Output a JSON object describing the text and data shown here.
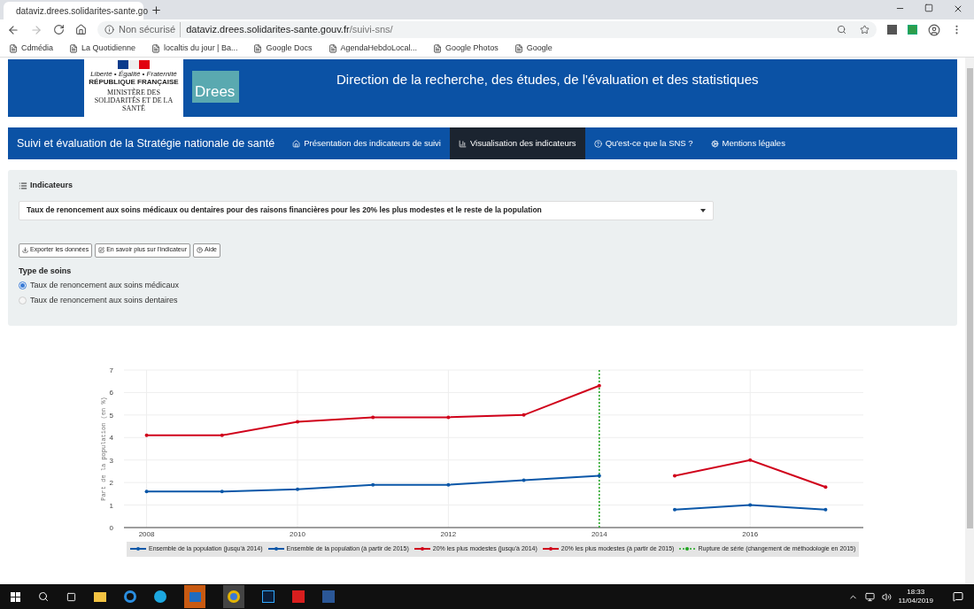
{
  "browser": {
    "tab_title": "dataviz.drees.solidarites-sante.go",
    "security": "Non sécurisé",
    "host": "dataviz.drees.solidarites-sante.gouv.fr",
    "path": "/suivi-sns/",
    "bookmarks": [
      "Cdmédia",
      "La Quotidienne",
      "localtis du jour | Ba...",
      "Google Docs",
      "AgendaHebdoLocal...",
      "Google Photos",
      "Google"
    ]
  },
  "header": {
    "republic_motto": "Liberté • Égalité • Fraternité",
    "republic": "RÉPUBLIQUE FRANÇAISE",
    "ministry": "MINISTÈRE DES SOLIDARITÉS ET DE LA SANTÉ",
    "drees_logo": "Drees",
    "title": "Direction de la recherche, des études, de l'évaluation et des statistiques"
  },
  "nav": {
    "brand": "Suivi et évaluation de la Stratégie nationale de santé",
    "items": [
      {
        "label": "Présentation des indicateurs de suivi",
        "selected": false
      },
      {
        "label": "Visualisation des indicateurs",
        "selected": true
      },
      {
        "label": "Qu'est-ce que la SNS ?",
        "selected": false
      },
      {
        "label": "Mentions légales",
        "selected": false
      }
    ]
  },
  "panel": {
    "heading": "Indicateurs",
    "select_value": "Taux de renoncement aux soins médicaux ou dentaires pour des raisons financières pour les 20% les plus modestes et le reste de la population",
    "buttons": [
      "Exporter les données",
      "En savoir plus sur l'indicateur",
      "Aide"
    ],
    "radio_label": "Type de soins",
    "options": [
      {
        "label": "Taux de renoncement aux soins médicaux",
        "selected": true
      },
      {
        "label": "Taux de renoncement aux soins dentaires",
        "selected": false
      }
    ]
  },
  "chart_data": {
    "type": "line",
    "ylabel": "Part de la population (en %)",
    "x": [
      2008,
      2009,
      2010,
      2011,
      2012,
      2013,
      2014,
      2015,
      2016,
      2017
    ],
    "xticks": [
      2008,
      2010,
      2012,
      2014,
      2016
    ],
    "yticks": [
      0,
      1,
      2,
      3,
      4,
      5,
      6,
      7
    ],
    "ylim": [
      0,
      7
    ],
    "xlim": [
      2007.7,
      2017.5
    ],
    "series": [
      {
        "name": "Ensemble de la population (jusqu'à 2014)",
        "color": "#0b57a8",
        "values": [
          1.6,
          1.6,
          1.7,
          1.9,
          1.9,
          2.1,
          2.3,
          null,
          null,
          null
        ]
      },
      {
        "name": "Ensemble de la population (à partir de 2015)",
        "color": "#0b57a8",
        "values": [
          null,
          null,
          null,
          null,
          null,
          null,
          null,
          0.8,
          1.0,
          0.8
        ]
      },
      {
        "name": "20% les plus modestes (jusqu'à 2014)",
        "color": "#d0021b",
        "values": [
          4.1,
          4.1,
          4.7,
          4.9,
          4.9,
          5.0,
          6.3,
          null,
          null,
          null
        ]
      },
      {
        "name": "20% les plus modestes (à partir de 2015)",
        "color": "#d0021b",
        "values": [
          null,
          null,
          null,
          null,
          null,
          null,
          null,
          2.3,
          3.0,
          1.8
        ]
      }
    ],
    "grid": true,
    "legend": "bottom",
    "ref_lines": [
      {
        "axis": "x",
        "value": 2014,
        "label": "Rupture de série (changement de méthodologie en 2015)",
        "color": "#1fa51f"
      }
    ]
  },
  "taskbar": {
    "time": "18:33",
    "date": "11/04/2019"
  }
}
